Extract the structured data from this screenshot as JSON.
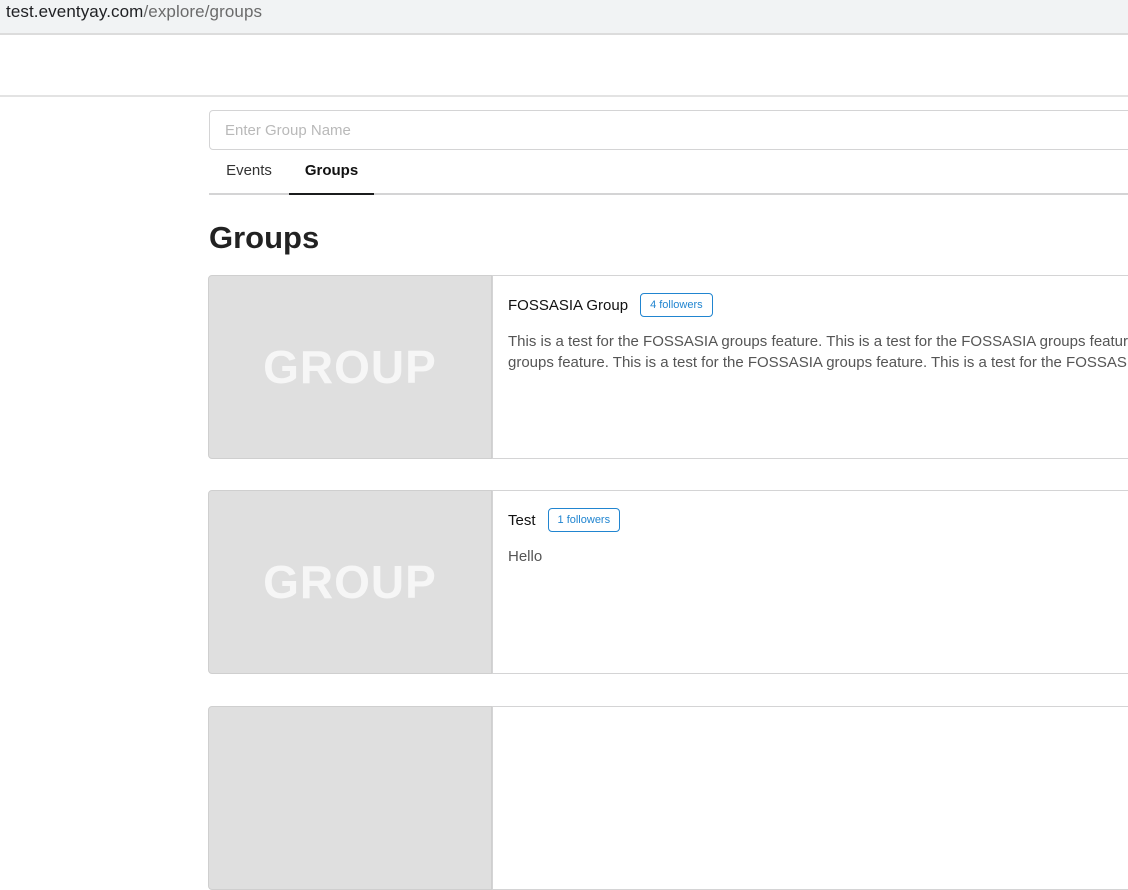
{
  "browser": {
    "url_host": "test.eventyay.com",
    "url_path": "/explore/groups"
  },
  "search": {
    "placeholder": "Enter Group Name",
    "value": ""
  },
  "tabs": {
    "events": "Events",
    "groups": "Groups",
    "active": "Groups"
  },
  "page": {
    "heading": "Groups"
  },
  "groups": [
    {
      "image_text": "GROUP",
      "name": "FOSSASIA Group",
      "followers": "4 followers",
      "description_line1": "This is a test for the FOSSASIA groups feature. This is a test for the FOSSASIA groups feature",
      "description_line2": "groups feature. This is a test for the FOSSASIA groups feature. This is a test for the FOSSASIA"
    },
    {
      "image_text": "GROUP",
      "name": "Test",
      "followers": "1 followers",
      "description_line1": "Hello",
      "description_line2": ""
    }
  ],
  "colors": {
    "accent": "#2185d0",
    "image_placeholder": "#dfdfdf"
  }
}
